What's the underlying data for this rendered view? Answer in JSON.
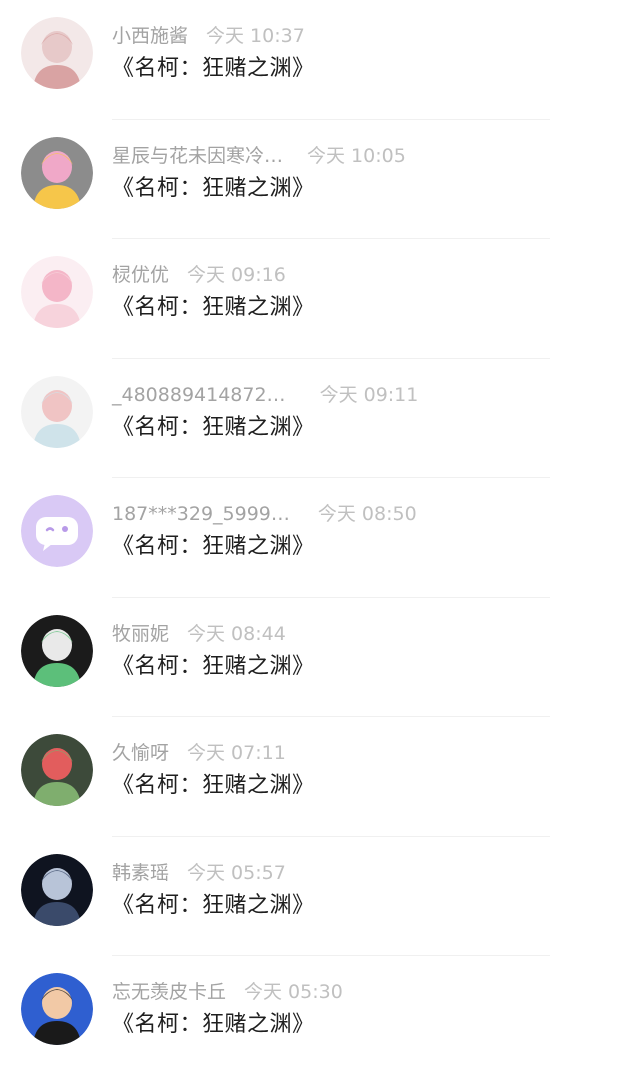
{
  "comments": [
    {
      "name": "小西施酱",
      "time": "今天 10:37",
      "message": "《名柯：狂赌之渊》",
      "avatar_colors": [
        "#f3e8e8",
        "#e7c9c9",
        "#d9a3a3"
      ]
    },
    {
      "name": "星辰与花未因寒冷…",
      "time": "今天 10:05",
      "message": "《名柯：狂赌之渊》",
      "avatar_colors": [
        "#8c8c8c",
        "#f0a8c8",
        "#f6c64a"
      ]
    },
    {
      "name": "棂优优",
      "time": "今天 09:16",
      "message": "《名柯：狂赌之渊》",
      "avatar_colors": [
        "#fbeef2",
        "#f4b6c8",
        "#f7d3dc"
      ]
    },
    {
      "name": "_480889414872…",
      "time": "今天 09:11",
      "message": "《名柯：狂赌之渊》",
      "avatar_colors": [
        "#f3f3f3",
        "#f0c4c4",
        "#cfe3ea"
      ]
    },
    {
      "name": "187***329_5999…",
      "time": "今天 08:50",
      "message": "《名柯：狂赌之渊》",
      "avatar_colors": [
        "#d9c9f5",
        "#ffffff",
        "#b89ae8"
      ]
    },
    {
      "name": "牧丽妮",
      "time": "今天 08:44",
      "message": "《名柯：狂赌之渊》",
      "avatar_colors": [
        "#1b1b1b",
        "#e9e9e9",
        "#5cbf7a"
      ]
    },
    {
      "name": "久愉呀",
      "time": "今天 07:11",
      "message": "《名柯：狂赌之渊》",
      "avatar_colors": [
        "#3d4a3a",
        "#e25d5d",
        "#7fae6e"
      ]
    },
    {
      "name": "韩素瑶",
      "time": "今天 05:57",
      "message": "《名柯：狂赌之渊》",
      "avatar_colors": [
        "#0f1420",
        "#b8c4d8",
        "#3a4a6a"
      ]
    },
    {
      "name": "忘无羡皮卡丘",
      "time": "今天 05:30",
      "message": "《名柯：狂赌之渊》",
      "avatar_colors": [
        "#2f5fd0",
        "#f2c9a6",
        "#1a1a1a"
      ]
    }
  ]
}
